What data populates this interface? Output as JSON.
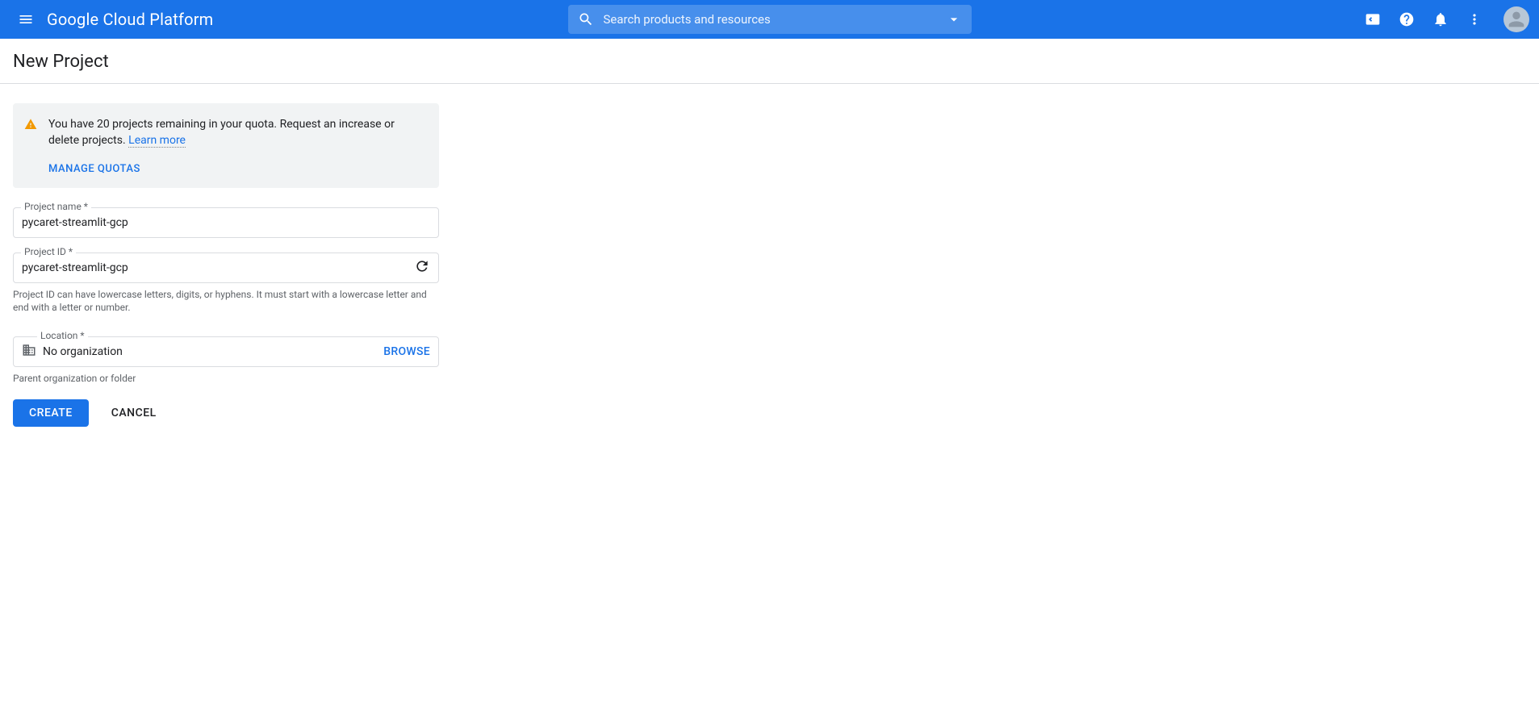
{
  "header": {
    "logo": "Google Cloud Platform",
    "search_placeholder": "Search products and resources"
  },
  "page": {
    "title": "New Project"
  },
  "notice": {
    "text": "You have 20 projects remaining in your quota. Request an increase or delete projects. ",
    "learn_more": "Learn more",
    "manage_link": "MANAGE QUOTAS"
  },
  "form": {
    "project_name_label": "Project name *",
    "project_name_value": "pycaret-streamlit-gcp",
    "project_id_label": "Project ID *",
    "project_id_value": "pycaret-streamlit-gcp",
    "project_id_help": "Project ID can have lowercase letters, digits, or hyphens. It must start with a lowercase letter and end with a letter or number.",
    "location_label": "Location *",
    "location_value": "No organization",
    "location_help": "Parent organization or folder",
    "browse": "BROWSE"
  },
  "actions": {
    "create": "CREATE",
    "cancel": "CANCEL"
  }
}
